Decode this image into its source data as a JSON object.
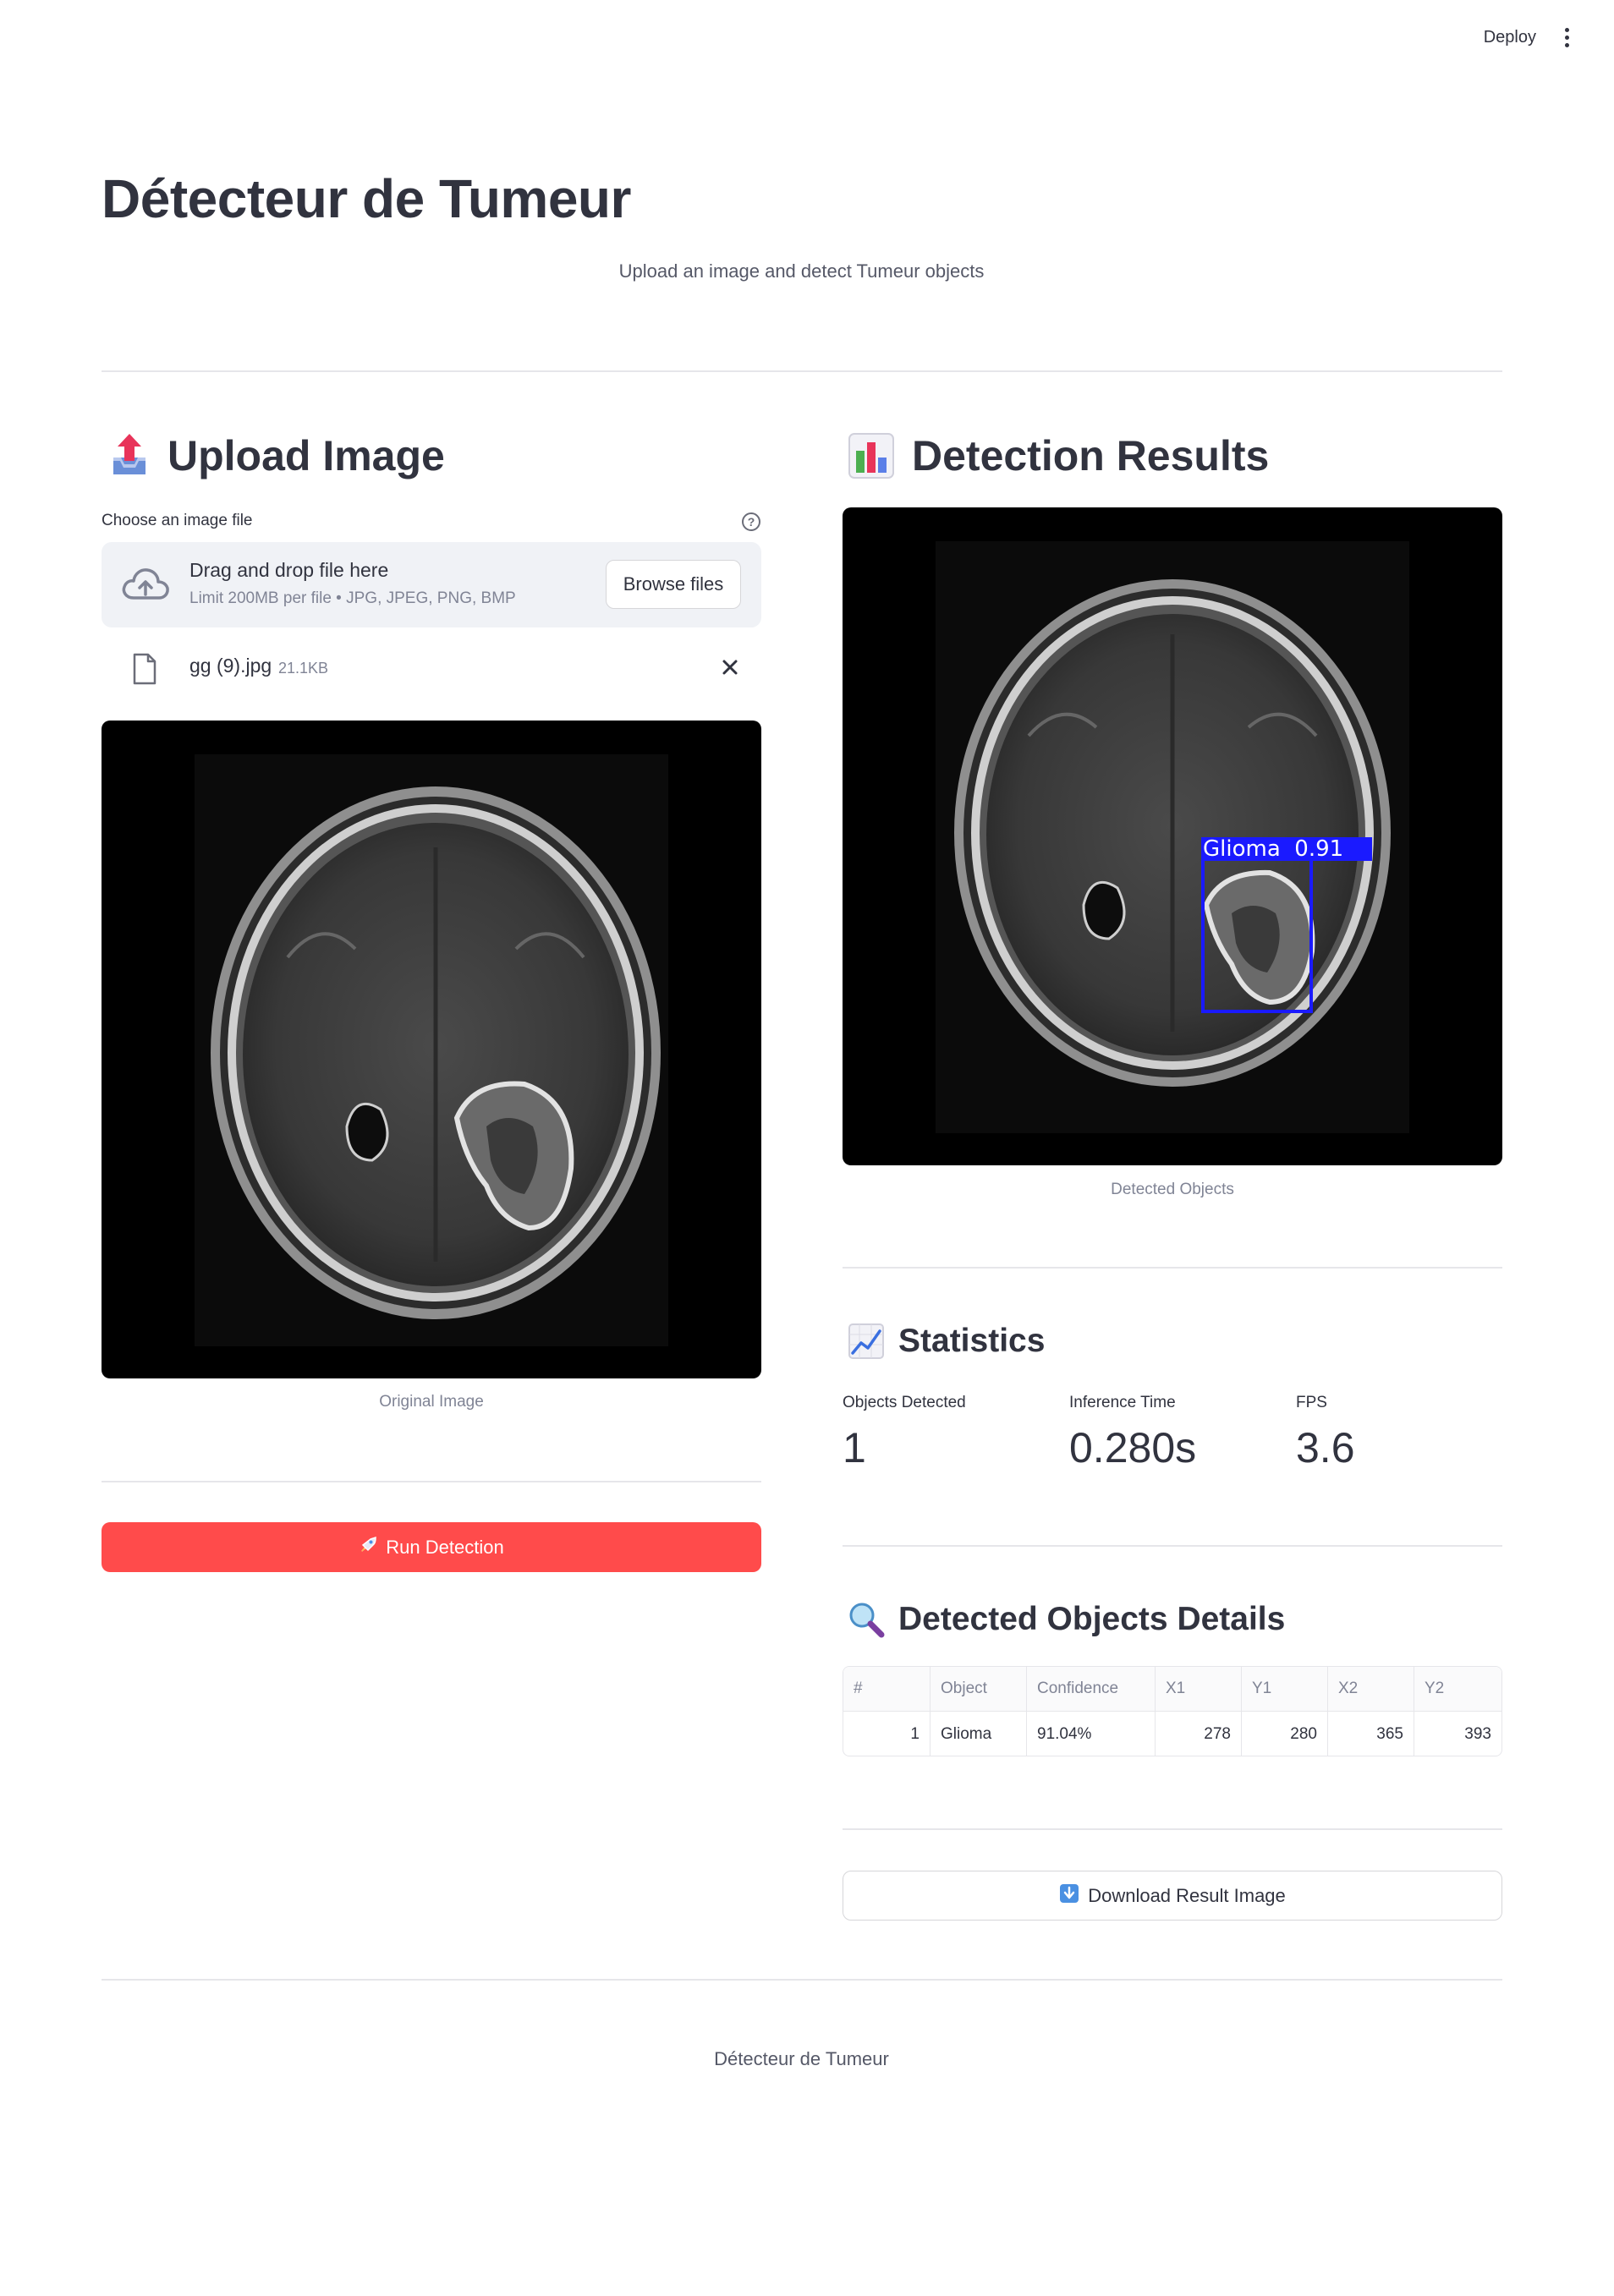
{
  "header": {
    "deploy_label": "Deploy"
  },
  "page": {
    "title": "Détecteur de Tumeur",
    "subtitle": "Upload an image and detect Tumeur objects"
  },
  "upload": {
    "heading": "Upload Image",
    "heading_icon": "outbox-tray-icon",
    "file_label": "Choose an image file",
    "help_glyph": "?",
    "drop_text": "Drag and drop file here",
    "limit_text": "Limit 200MB per file • JPG, JPEG, PNG, BMP",
    "browse_label": "Browse files",
    "file": {
      "name": "gg (9).jpg",
      "size": "21.1KB"
    },
    "image_caption": "Original Image",
    "run_label": "Run Detection",
    "run_icon": "rocket-icon"
  },
  "results": {
    "heading": "Detection Results",
    "heading_icon": "bar-chart-icon",
    "image_caption": "Detected Objects",
    "box_label": "Glioma  0.91",
    "box_color": "#1a1aff"
  },
  "statistics": {
    "heading": "Statistics",
    "heading_icon": "chart-increasing-icon",
    "metrics": [
      {
        "label": "Objects Detected",
        "value": "1"
      },
      {
        "label": "Inference Time",
        "value": "0.280s"
      },
      {
        "label": "FPS",
        "value": "3.6"
      }
    ]
  },
  "details": {
    "heading": "Detected Objects Details",
    "heading_icon": "magnifying-glass-icon",
    "columns": [
      "#",
      "Object",
      "Confidence",
      "X1",
      "Y1",
      "X2",
      "Y2"
    ],
    "rows": [
      [
        "1",
        "Glioma",
        "91.04%",
        "278",
        "280",
        "365",
        "393"
      ]
    ]
  },
  "download": {
    "label": "Download Result Image",
    "icon": "down-arrow-icon"
  },
  "footer": {
    "text": "Détecteur de Tumeur"
  },
  "colors": {
    "primary": "#ff4b4b",
    "text": "#31333f",
    "muted": "#808495"
  }
}
